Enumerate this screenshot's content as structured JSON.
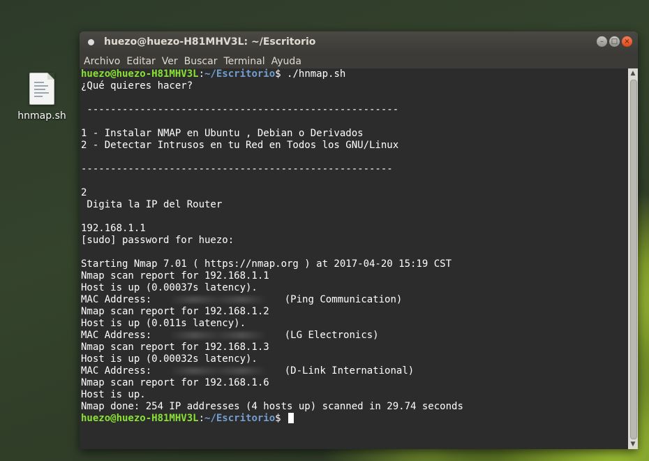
{
  "desktop": {
    "icon_label": "hnmap.sh",
    "icon_name": "shell-script-file-icon"
  },
  "window": {
    "title": "huezo@huezo-H81MHV3L: ~/Escritorio",
    "controls": {
      "minimize": "–",
      "maximize": "□",
      "close": "×"
    }
  },
  "menubar": [
    "Archivo",
    "Editar",
    "Ver",
    "Buscar",
    "Terminal",
    "Ayuda"
  ],
  "terminal": {
    "prompt_user": "huezo@huezo-H81MHV3L",
    "prompt_sep": ":",
    "prompt_path": "~/Escritorio",
    "prompt_end": "$ ",
    "command": "./hnmap.sh",
    "lines": [
      "¿Qué quieres hacer?",
      "",
      " -----------------------------------------------------",
      "",
      "1 - Instalar NMAP en Ubuntu , Debian o Derivados",
      "2 - Detectar Intrusos en tu Red en Todos los GNU/Linux",
      "",
      "-----------------------------------------------------",
      "",
      "2",
      " Digita la IP del Router",
      "",
      "192.168.1.1",
      "[sudo] password for huezo:",
      "",
      "Starting Nmap 7.01 ( https://nmap.org ) at 2017-04-20 15:19 CST",
      "Nmap scan report for 192.168.1.1",
      "Host is up (0.00037s latency)."
    ],
    "mac_prefix": "MAC Address:",
    "hosts": [
      {
        "vendor": "(Ping Communication)",
        "next_report": "Nmap scan report for 192.168.1.2",
        "next_up": "Host is up (0.011s latency)."
      },
      {
        "vendor": "(LG Electronics)",
        "next_report": "Nmap scan report for 192.168.1.3",
        "next_up": "Host is up (0.00032s latency)."
      },
      {
        "vendor": "(D-Link International)",
        "next_report": "Nmap scan report for 192.168.1.6",
        "next_up": "Host is up."
      }
    ],
    "done_line": "Nmap done: 254 IP addresses (4 hosts up) scanned in 29.74 seconds"
  },
  "colors": {
    "terminal_bg": "#2c2c2c",
    "prompt_user": "#8ae234",
    "prompt_path": "#729fcf",
    "close_button": "#dd4814"
  }
}
